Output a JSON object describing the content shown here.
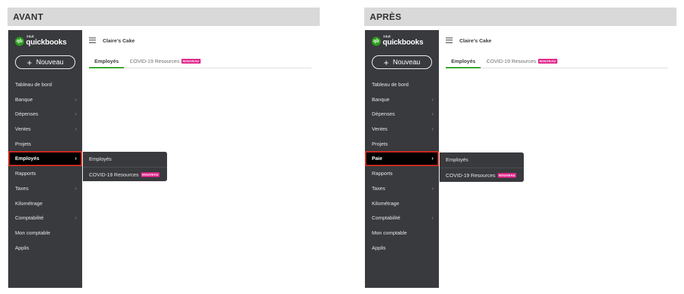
{
  "panels": {
    "before": {
      "label": "AVANT",
      "logo": {
        "intuit": "intuit",
        "word": "quickbooks",
        "mark": "qb"
      },
      "new_button": {
        "icon": "+",
        "label": "Nouveau"
      },
      "nav": [
        {
          "label": "Tableau de bord",
          "chevron": ""
        },
        {
          "label": "Banque",
          "chevron": "›"
        },
        {
          "label": "Dépenses",
          "chevron": "›"
        },
        {
          "label": "Ventes",
          "chevron": "›"
        },
        {
          "label": "Projets",
          "chevron": ""
        },
        {
          "label": "Employés",
          "chevron": "›"
        },
        {
          "label": "Rapports",
          "chevron": ""
        },
        {
          "label": "Taxes",
          "chevron": "›"
        },
        {
          "label": "Kilométrage",
          "chevron": ""
        },
        {
          "label": "Comptabilité",
          "chevron": "›"
        },
        {
          "label": "Mon comptable",
          "chevron": ""
        },
        {
          "label": "Applis",
          "chevron": ""
        }
      ],
      "company": "Claire's Cake",
      "tabs": [
        {
          "label": "Employés",
          "badge": ""
        },
        {
          "label": "COVID-19 Resources",
          "badge": "NOUVEAU"
        }
      ],
      "flyout": [
        {
          "label": "Employés",
          "badge": ""
        },
        {
          "label": "COVID-19 Resources",
          "badge": "NOUVEAU"
        }
      ]
    },
    "after": {
      "label": "APRÈS",
      "logo": {
        "intuit": "intuit",
        "word": "quickbooks",
        "mark": "qb"
      },
      "new_button": {
        "icon": "+",
        "label": "Nouveau"
      },
      "nav": [
        {
          "label": "Tableau de bord",
          "chevron": ""
        },
        {
          "label": "Banque",
          "chevron": "›"
        },
        {
          "label": "Dépenses",
          "chevron": "›"
        },
        {
          "label": "Ventes",
          "chevron": "›"
        },
        {
          "label": "Projets",
          "chevron": ""
        },
        {
          "label": "Paie",
          "chevron": "›"
        },
        {
          "label": "Rapports",
          "chevron": ""
        },
        {
          "label": "Taxes",
          "chevron": "›"
        },
        {
          "label": "Kilométrage",
          "chevron": ""
        },
        {
          "label": "Comptabilité",
          "chevron": "›"
        },
        {
          "label": "Mon comptable",
          "chevron": ""
        },
        {
          "label": "Applis",
          "chevron": ""
        }
      ],
      "company": "Claire's Cake",
      "tabs": [
        {
          "label": "Employés",
          "badge": ""
        },
        {
          "label": "COVID-19 Resources",
          "badge": "NOUVEAU"
        }
      ],
      "flyout": [
        {
          "label": "Employés",
          "badge": ""
        },
        {
          "label": "COVID-19 Resources",
          "badge": "NOUVEAU"
        }
      ]
    }
  },
  "colors": {
    "sidebar": "#393a3d",
    "brand_green": "#2ca01c",
    "highlight_red": "#d52b1e",
    "badge_pink": "#e0278b"
  }
}
